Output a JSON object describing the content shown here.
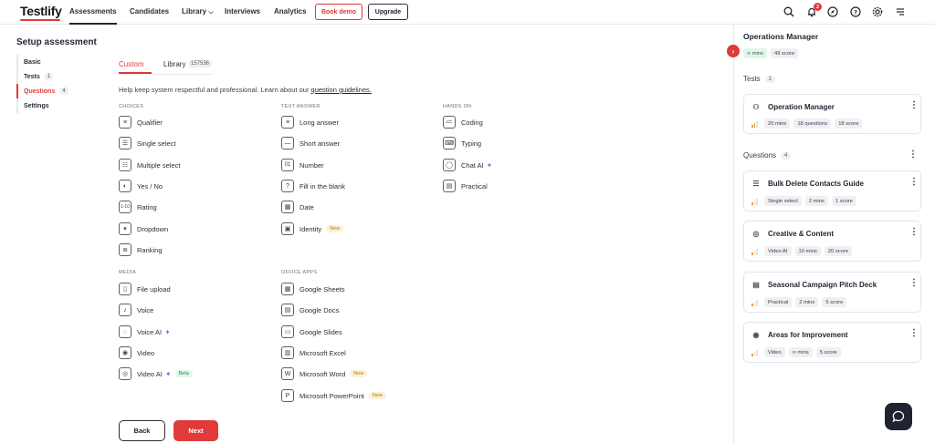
{
  "nav": {
    "logo": "Testlify",
    "links": [
      "Assessments",
      "Candidates",
      "Library",
      "Interviews",
      "Analytics"
    ],
    "library_caret": "⌵",
    "book_demo": "Book demo",
    "upgrade": "Upgrade",
    "notification_count": "2",
    "icons": [
      "search-icon",
      "bell-icon",
      "compass-icon",
      "help-icon",
      "gear-icon",
      "menu-icon"
    ]
  },
  "page": {
    "title": "Setup assessment",
    "steps": [
      {
        "label": "Basic",
        "count": ""
      },
      {
        "label": "Tests",
        "count": "1"
      },
      {
        "label": "Questions",
        "count": "4"
      },
      {
        "label": "Settings",
        "count": ""
      }
    ],
    "active_step": "Questions"
  },
  "tabs": {
    "custom": "Custom",
    "library": "Library",
    "library_count": "157536"
  },
  "help": {
    "text": "Help keep system respectful and professional. Learn about our ",
    "link": "question guidelines."
  },
  "sections": {
    "choices": "CHOICES",
    "text_answer": "TEXT ANSWER",
    "hands_on": "HANDS ON",
    "media": "MEDIA",
    "office_apps": "OFFICE APPS"
  },
  "choices": [
    "Qualifier",
    "Single select",
    "Multiple select",
    "Yes / No",
    "Rating",
    "Dropdown",
    "Ranking"
  ],
  "text_answer": [
    "Long answer",
    "Short answer",
    "Number",
    "Fill in the blank",
    "Date",
    "Identity"
  ],
  "hands_on": [
    "Coding",
    "Typing",
    "Chat AI",
    "Practical"
  ],
  "media": [
    "File upload",
    "Voice",
    "Voice AI",
    "Video",
    "Video AI"
  ],
  "office_apps": [
    "Google Sheets",
    "Google Docs",
    "Google Slides",
    "Microsoft Excel",
    "Microsoft Word",
    "Microsoft PowerPoint"
  ],
  "badges": {
    "new": "New",
    "beta": "Beta"
  },
  "buttons": {
    "back": "Back",
    "next": "Next"
  },
  "right_panel": {
    "title": "Operations Manager",
    "duration": "∞ mins",
    "score": "49 score",
    "tests_label": "Tests",
    "tests_count": "1",
    "test_card": {
      "title": "Operation Manager",
      "pills": [
        "20 mins",
        "18 questions",
        "18 score"
      ]
    },
    "questions_label": "Questions",
    "questions_count": "4",
    "question_cards": [
      {
        "title": "Bulk Delete Contacts Guide",
        "pills": [
          "Single select",
          "2 mins",
          "1 score"
        ]
      },
      {
        "title": "Creative & Content",
        "pills": [
          "Video AI",
          "10 mins",
          "20 score"
        ]
      },
      {
        "title": "Seasonal Campaign Pitch Deck",
        "pills": [
          "Practical",
          "2 mins",
          "5 score"
        ]
      },
      {
        "title": "Areas for Improvement",
        "pills": [
          "Video",
          "∞ mins",
          "5 score"
        ]
      }
    ]
  },
  "colors": {
    "accent": "#e03a3a",
    "text": "#1f2430",
    "muted": "#6b7180",
    "ai_spark": "#8a6cf0"
  }
}
